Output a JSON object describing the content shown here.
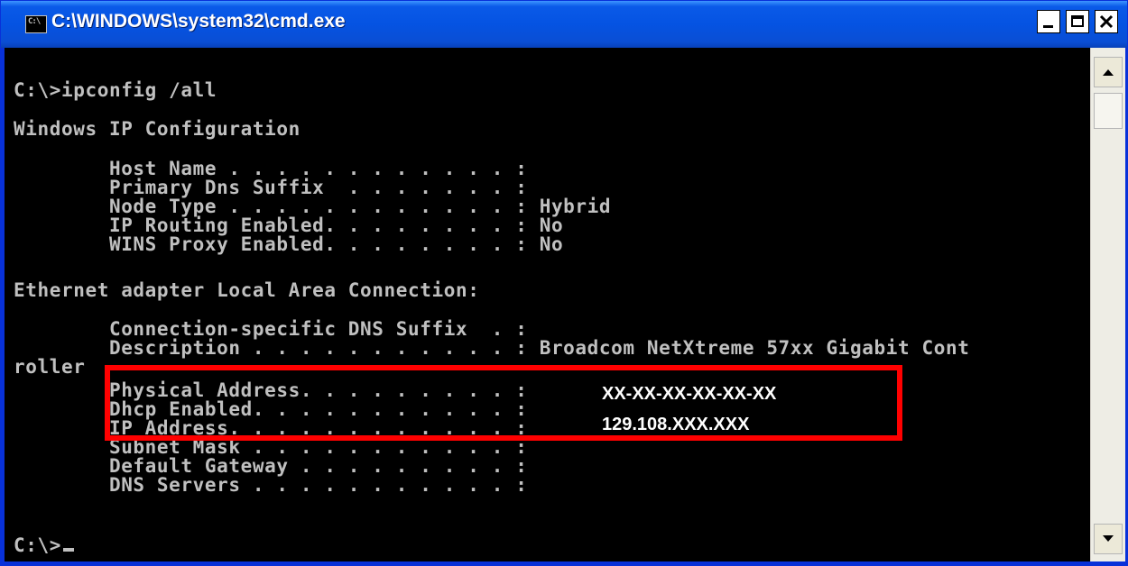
{
  "window": {
    "title": "C:\\WINDOWS\\system32\\cmd.exe",
    "icon": "console-app-icon",
    "icon_text": "C:\\"
  },
  "title_buttons": {
    "minimize": "minimize-icon",
    "maximize": "maximize-icon",
    "close": "close-icon"
  },
  "console": {
    "lines": [
      "C:\\>ipconfig /all",
      "Windows IP Configuration",
      "        Host Name . . . . . . . . . . . . :",
      "        Primary Dns Suffix  . . . . . . . :",
      "        Node Type . . . . . . . . . . . . : Hybrid",
      "        IP Routing Enabled. . . . . . . . : No",
      "        WINS Proxy Enabled. . . . . . . . : No",
      "Ethernet adapter Local Area Connection:",
      "        Connection-specific DNS Suffix  . :",
      "        Description . . . . . . . . . . . : Broadcom NetXtreme 57xx Gigabit Cont",
      "roller",
      "        Physical Address. . . . . . . . . :",
      "        Dhcp Enabled. . . . . . . . . . . :",
      "        IP Address. . . . . . . . . . . . :",
      "        Subnet Mask . . . . . . . . . . . :",
      "        Default Gateway . . . . . . . . . :",
      "        DNS Servers . . . . . . . . . . . :",
      "C:\\>"
    ]
  },
  "redaction": {
    "physical_address": "XX-XX-XX-XX-XX-XX",
    "ip_address": "129.108.XXX.XXX",
    "box_color": "#ff0000"
  },
  "colors": {
    "title_bar": "#0553e2",
    "console_bg": "#000000",
    "console_text": "#c0c0c0"
  }
}
